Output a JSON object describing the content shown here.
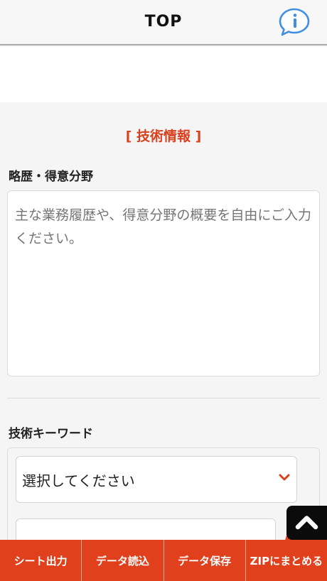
{
  "header": {
    "title": "TOP",
    "info_icon": "info-bubble-icon"
  },
  "section": {
    "title": "[ 技術情報 ]"
  },
  "history": {
    "label": "略歴・得意分野",
    "placeholder": "主な業務履歴や、得意分野の概要を自由にご入力ください。"
  },
  "keywords": {
    "label": "技術キーワード",
    "select_value": "選択してください",
    "select_icon": "chevron-down-icon",
    "remove_icon": "minus-icon"
  },
  "scroll_top": {
    "icon": "chevron-up-icon"
  },
  "bottom_bar": {
    "buttons": [
      "シート出力",
      "データ読込",
      "データ保存",
      "ZIPにまとめる"
    ]
  },
  "colors": {
    "accent": "#e0401c",
    "section_title": "#d9411e",
    "info_icon": "#3f8fe0"
  }
}
